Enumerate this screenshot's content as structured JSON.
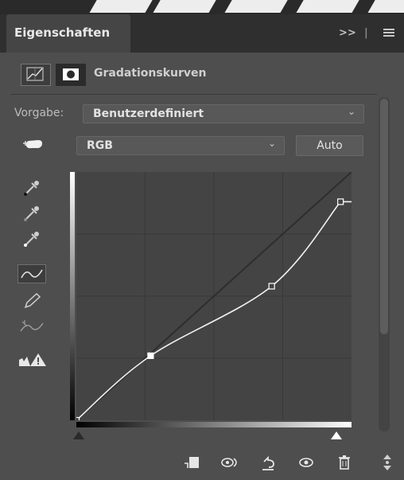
{
  "panel": {
    "tab_title": "Eigenschaften",
    "collapse_label": ">>",
    "adjustment_title": "Gradationskurven"
  },
  "preset": {
    "label": "Vorgabe:",
    "value": "Benutzerdefiniert"
  },
  "channel": {
    "value": "RGB"
  },
  "auto_button": "Auto",
  "tools": [
    "on-image-adjust-icon",
    "black-point-eyedropper-icon",
    "gray-point-eyedropper-icon",
    "white-point-eyedropper-icon",
    "curve-point-tool-icon",
    "pencil-tool-icon",
    "smooth-curve-icon",
    "clipping-warning-icon"
  ],
  "curve": {
    "points": [
      [
        0,
        0
      ],
      [
        0.27,
        0.26
      ],
      [
        0.71,
        0.54
      ],
      [
        0.96,
        0.88
      ]
    ]
  },
  "bottom_icons": [
    "clip-to-layer-icon",
    "view-previous-state-icon",
    "reset-icon",
    "visibility-eye-icon",
    "delete-trash-icon"
  ]
}
